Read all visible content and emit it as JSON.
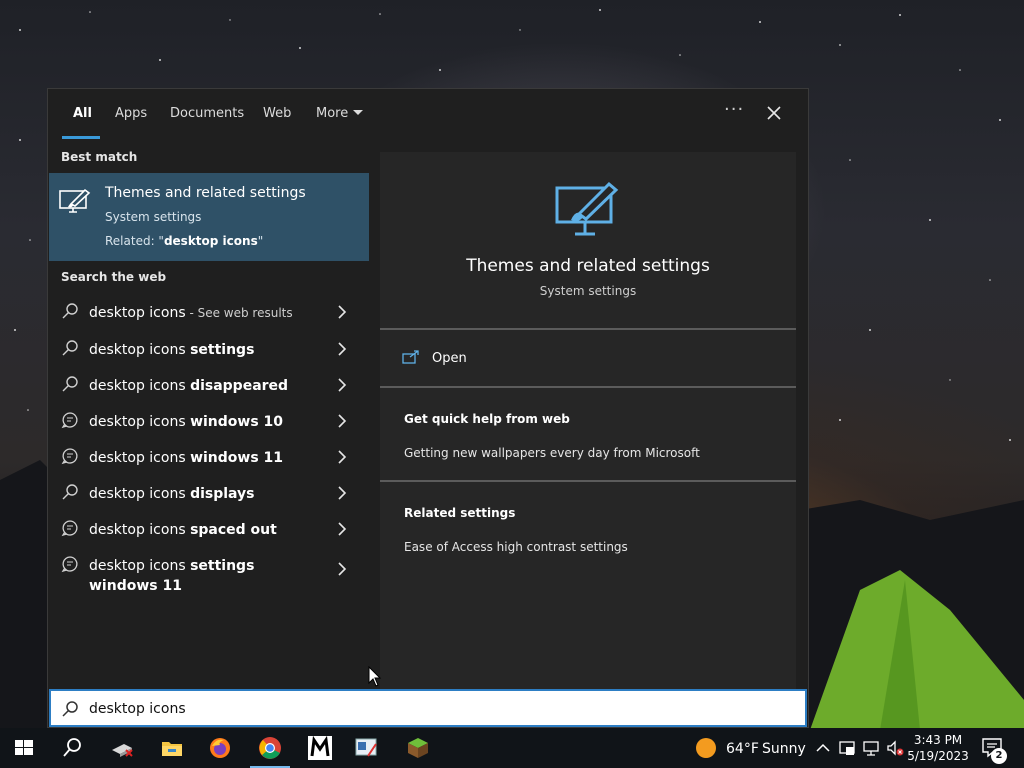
{
  "search_panel": {
    "tabs": [
      {
        "label": "All"
      },
      {
        "label": "Apps"
      },
      {
        "label": "Documents"
      },
      {
        "label": "Web"
      },
      {
        "label": "More"
      }
    ],
    "more_options_label": "···",
    "best_match": {
      "section_label": "Best match",
      "title": "Themes and related settings",
      "subtitle": "System settings",
      "related_prefix": "Related: \"",
      "related_term": "desktop icons",
      "related_suffix": "\""
    },
    "search_web": {
      "section_label": "Search the web",
      "items": [
        {
          "base": "desktop icons",
          "suffix": "",
          "note": " - See web results",
          "icon": "search-icon"
        },
        {
          "base": "desktop icons ",
          "suffix": "settings",
          "note": "",
          "icon": "search-icon"
        },
        {
          "base": "desktop icons ",
          "suffix": "disappeared",
          "note": "",
          "icon": "search-icon"
        },
        {
          "base": "desktop icons ",
          "suffix": "windows 10",
          "note": "",
          "icon": "chat-bubble-icon"
        },
        {
          "base": "desktop icons ",
          "suffix": "windows 11",
          "note": "",
          "icon": "chat-bubble-icon"
        },
        {
          "base": "desktop icons ",
          "suffix": "displays",
          "note": "",
          "icon": "search-icon"
        },
        {
          "base": "desktop icons ",
          "suffix": "spaced out",
          "note": "",
          "icon": "chat-bubble-icon"
        },
        {
          "base": "desktop icons ",
          "suffix": "settings windows 11",
          "note": "",
          "icon": "chat-bubble-icon"
        }
      ]
    },
    "preview": {
      "title": "Themes and related settings",
      "subtitle": "System settings",
      "open_label": "Open",
      "quick_help_heading": "Get quick help from web",
      "quick_help_link": "Getting new wallpapers every day from Microsoft",
      "related_heading": "Related settings",
      "related_link": "Ease of Access high contrast settings"
    },
    "search_box": {
      "value": "desktop icons"
    }
  },
  "taskbar": {
    "apps": [
      "start-icon",
      "search-icon",
      "app-icon",
      "file-explorer-icon",
      "firefox-icon",
      "chrome-icon",
      "m-app-icon",
      "screen-tool-icon",
      "minecraft-icon"
    ],
    "weather": {
      "temp": "64°F",
      "condition": "Sunny"
    },
    "clock": {
      "time": "3:43 PM",
      "date": "5/19/2023"
    },
    "notifications_count": "2"
  },
  "colors": {
    "accent": "#3a9ad9",
    "selected_bg": "#2f5167",
    "panel_bg": "#1f1f1f",
    "preview_bg": "#262626",
    "taskbar_bg": "#101418"
  }
}
